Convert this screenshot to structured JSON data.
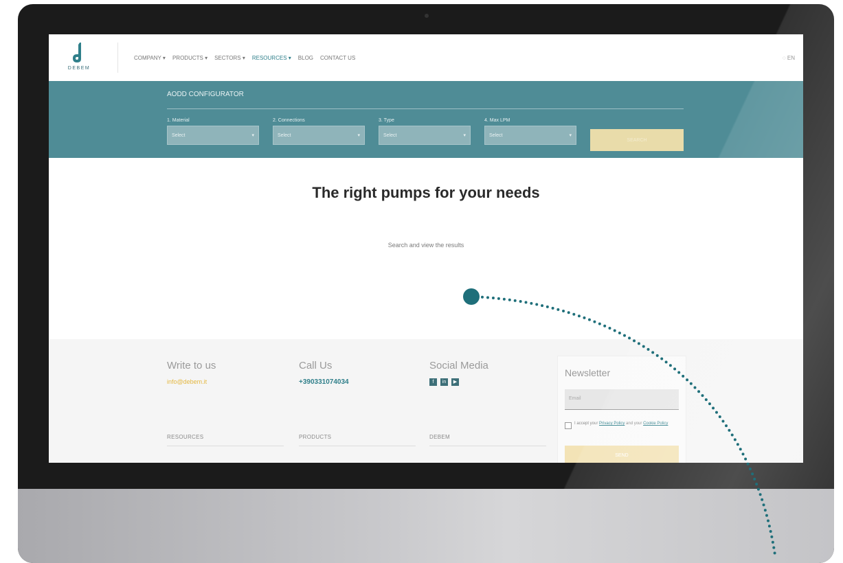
{
  "nav": {
    "brand": "DEBEM",
    "items": [
      "COMPANY ▾",
      "PRODUCTS ▾",
      "SECTORS ▾",
      "RESOURCES ▾",
      "BLOG",
      "CONTACT US"
    ],
    "lang": "EN",
    "lang_icon": "globe-icon"
  },
  "configurator": {
    "title": "AODD CONFIGURATOR",
    "fields": [
      {
        "label": "1. Material",
        "value": "Select"
      },
      {
        "label": "2. Connections",
        "value": "Select"
      },
      {
        "label": "3. Type",
        "value": "Select"
      },
      {
        "label": "4. Max LPM",
        "value": "Select"
      }
    ],
    "button": "SEARCH"
  },
  "hero": {
    "title": "The right pumps for your needs",
    "subtitle": "Search and view the results"
  },
  "footer": {
    "write": {
      "heading": "Write to us",
      "email": "info@debem.it"
    },
    "call": {
      "heading": "Call Us",
      "phone": "+390331074034"
    },
    "social": {
      "heading": "Social Media",
      "icons": [
        "f",
        "in",
        "▶"
      ]
    },
    "sections": [
      "RESOURCES",
      "PRODUCTS",
      "DEBEM"
    ],
    "newsletter": {
      "heading": "Newsletter",
      "placeholder": "Email",
      "consent_prefix": "I accept your",
      "privacy": "Privacy Policy",
      "consent_mid": "and your",
      "cookie": "Cookie Policy",
      "button": "SEND"
    }
  },
  "colors": {
    "teal": "#4f8c96",
    "accent": "#e4b740",
    "connector": "#1f6f7a"
  }
}
